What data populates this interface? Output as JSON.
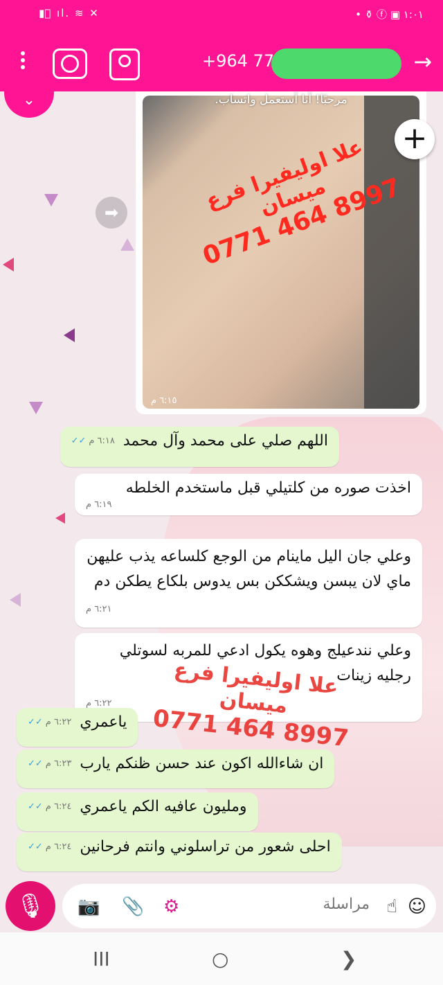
{
  "status_bar": {
    "left_icons": "▮⃠ ıl. ≋ ✕",
    "right_text": "• ⚱ ⓕ ▣ ١:٠١"
  },
  "header": {
    "phone_number": "+964 77",
    "back_arrow": "→"
  },
  "media_message": {
    "caption": "مرحبًا! أنا أستعمل واتساب.",
    "watermark_name": "علا اوليفيرا فرع ميسان",
    "watermark_phone": "0771 464 8997",
    "time": "٦:١٥ م"
  },
  "messages": [
    {
      "direction": "out",
      "text": "اللهم صلي على محمد وآل محمد",
      "time": "٦:١٨ م"
    },
    {
      "direction": "in",
      "text": "اخذت صوره من كلتيلي  قبل ماستخدم الخلطه",
      "time": "٦:١٩ م"
    },
    {
      "direction": "in",
      "text": "وعلي جان اليل ماينام من  الوجع كلساعه يذب عليهن ماي لان يبسن ويشككن  بس يدوس بلكاع يطكن دم",
      "time": "٦:٢١ م"
    },
    {
      "direction": "in",
      "text": "وعلي نندعيلج وهوه يكول ادعي للمربه لسوتلي رجليه زينات",
      "time": "٦:٢٢ م"
    },
    {
      "direction": "out",
      "text": "ياعمري",
      "time": "٦:٢٢ م"
    },
    {
      "direction": "out",
      "text": "ان شاءالله اكون عند حسن ظنكم يارب",
      "time": "٦:٢٣ م"
    },
    {
      "direction": "out",
      "text": "ومليون عافيه الكم ياعمري",
      "time": "٦:٢٤ م"
    },
    {
      "direction": "out",
      "text": "احلى شعور من تراسلوني وانتم فرحانين",
      "time": "٦:٢٤ م"
    }
  ],
  "overlay_watermark": {
    "name": "علا اوليفيرا فرع ميسان",
    "phone": "0771 464 8997"
  },
  "composer": {
    "placeholder": "مراسلة",
    "mic_icon": "mic-icon",
    "camera_icon": "camera-icon",
    "attach_icon": "paperclip-icon",
    "settings_icon": "gear-icon",
    "emoji_icon": "emoji-icon"
  },
  "colors": {
    "brand": "#ff1493",
    "outgoing_bubble": "#e4f7cf",
    "incoming_bubble": "#ffffff",
    "mic_button": "#e3106f",
    "read_ticks": "#3a9fdc"
  },
  "nav": {
    "recents": "III",
    "home": "○",
    "back": "❯"
  }
}
